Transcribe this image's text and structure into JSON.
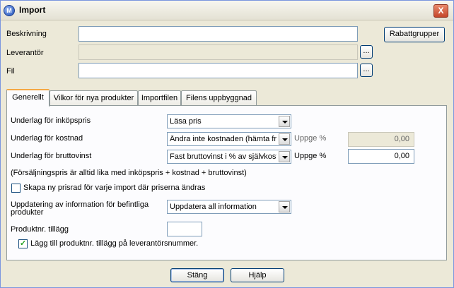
{
  "window": {
    "title": "Import",
    "close_label": "X"
  },
  "form": {
    "beskrivning_label": "Beskrivning",
    "leverantor_label": "Leverantör",
    "fil_label": "Fil",
    "beskrivning_value": "",
    "leverantor_value": "",
    "fil_value": "",
    "browse_label": "...",
    "rabattgrupper_label": "Rabattgrupper"
  },
  "tabs": [
    {
      "label": "Generellt",
      "active": true
    },
    {
      "label": "Vilkor för nya produkter",
      "active": false
    },
    {
      "label": "Importfilen",
      "active": false
    },
    {
      "label": "Filens uppbyggnad",
      "active": false
    }
  ],
  "generellt": {
    "inkopspris_label": "Underlag för inköpspris",
    "inkopspris_value": "Läsa pris",
    "kostnad_label": "Underlag för kostnad",
    "kostnad_value": "Ändra inte kostnaden (hämta frå",
    "kostnad_uppge_label": "Uppge %",
    "kostnad_uppge_value": "0,00",
    "bruttovinst_label": "Underlag för bruttovinst",
    "bruttovinst_value": "Fast bruttovinst i % av självkostr",
    "bruttovinst_uppge_label": "Uppge %",
    "bruttovinst_uppge_value": "0,00",
    "note": "(Försäljningspris är alltid lika med inköpspris + kostnad + bruttovinst)",
    "skapa_prisrad_label": "Skapa ny prisrad för varje import där priserna ändras",
    "skapa_prisrad_checked": false,
    "uppdatering_label_line1": "Uppdatering av information för befintliga",
    "uppdatering_label_line2": "produkter",
    "uppdatering_value": "Uppdatera all information",
    "produktnr_tillagg_label": "Produktnr. tillägg",
    "produktnr_tillagg_value": "",
    "lagg_till_label": "Lägg till produktnr. tillägg på leverantörsnummer.",
    "lagg_till_checked": true
  },
  "footer": {
    "stang_label": "Stäng",
    "hjalp_label": "Hjälp"
  }
}
